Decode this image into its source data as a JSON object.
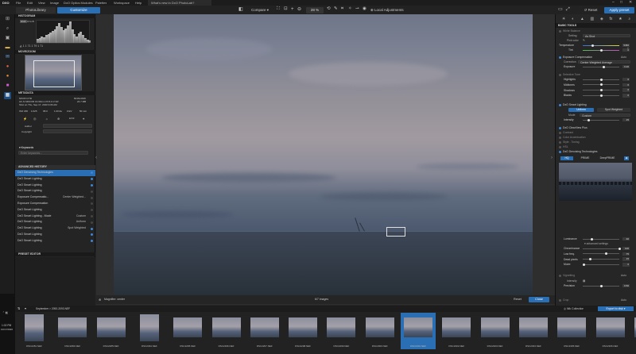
{
  "titlebar": {
    "app_name": "DXO",
    "menu": [
      "File",
      "Edit",
      "View",
      "Image",
      "DxO Optics Modules",
      "Palettes",
      "Workspace",
      "Help"
    ],
    "doc_tab": "What's new in DxO PhotoLab?"
  },
  "toolbar": {
    "tab_library": "PhotoLibrary",
    "tab_customize": "Customize",
    "compare_label": "Compare",
    "zoom_value": "28 %",
    "local_adjustments": "Local Adjustments",
    "reset_label": "Reset",
    "apply_preset": "Apply preset"
  },
  "left_panel": {
    "histogram_title": "HISTOGRAM",
    "histogram_channels": [
      "RGB",
      "R",
      "G",
      "B",
      "L"
    ],
    "histogram_values": [
      "1",
      "1",
      "71",
      "1",
      "79",
      "1",
      "71"
    ],
    "histogram_bars": [
      0.18,
      0.22,
      0.3,
      0.26,
      0.34,
      0.4,
      0.48,
      0.55,
      0.62,
      0.74,
      0.9,
      0.7,
      0.58,
      0.66,
      0.8,
      0.95,
      0.62,
      0.4,
      0.3,
      0.42,
      0.5,
      0.36,
      0.22,
      0.14,
      0.1
    ],
    "move_zoom_title": "MOVE/ZOOM",
    "metadata_title": "METADATA",
    "meta_camera": "NIKON Z 50",
    "meta_res": "6016x4016",
    "meta_lens": "AF-S NIKKOR 16-50mm f/3.5-6.3 VR",
    "meta_size": "24.7 MB",
    "meta_date": "Shot on Thu, Sep 17, 2020 9:06 AM",
    "exif": [
      "ISO 180",
      "1/125",
      "f/8.0",
      "1.00 Ev",
      "0 EV",
      "50 mm"
    ],
    "meta_icons_label": "EXIF",
    "author_label": "Author",
    "copyright_label": "Copyright",
    "keywords_label": "Keywords",
    "keywords_placeholder": "Enter keywords...",
    "adv_history_title": "ADVANCED HISTORY",
    "history_items": [
      {
        "label": "DxO Denoising Technologies",
        "value": "",
        "selected": true
      },
      {
        "label": "DxO Smart Lighting",
        "value": "",
        "selected": false
      },
      {
        "label": "DxO Smart Lighting",
        "value": "",
        "selected": false
      },
      {
        "label": "DxO Smart Lighting",
        "value": "",
        "selected": false
      },
      {
        "label": "Exposure Compensatio...",
        "value": "Center Weighted...",
        "selected": false
      },
      {
        "label": "Exposure Compensation",
        "value": "",
        "selected": false
      },
      {
        "label": "DxO Smart Lighting",
        "value": "",
        "selected": false
      },
      {
        "label": "DxO Smart Lighting - Mode",
        "value": "Custom",
        "selected": false
      },
      {
        "label": "DxO Smart Lighting",
        "value": "Uniform",
        "selected": false
      },
      {
        "label": "DxO Smart Lighting",
        "value": "Spot Weighted",
        "selected": false
      },
      {
        "label": "DxO Smart Lighting",
        "value": "",
        "selected": false
      },
      {
        "label": "DxO Smart Lighting",
        "value": "",
        "selected": false
      }
    ],
    "preset_editor_title": "PRESET EDITOR"
  },
  "viewer": {
    "magnifier_label": "Magnifier: center",
    "count_label": "6/7 images",
    "reset_label": "Reset",
    "close_label": "Close"
  },
  "right_panel": {
    "basic_tools_title": "BASIC TOOLS",
    "white_balance": "White Balance",
    "wb_setting_label": "Setting",
    "wb_setting_value": "As Shot",
    "wb_picker_label": "Pick color",
    "temp_label": "Temperature",
    "temp_value": "5450 K",
    "tint_label": "Tint",
    "tint_value": "0",
    "exposure_title": "Exposure Compensation",
    "exposure_auto": "Auto",
    "correction_label": "Correction",
    "correction_value": "Center Weighted Average",
    "exposure_label": "Exposure",
    "exposure_value": "0.20",
    "selective_tone": "Selective Tone",
    "tones": [
      {
        "label": "Highlights",
        "value": "0"
      },
      {
        "label": "Midtones",
        "value": "0"
      },
      {
        "label": "Shadows",
        "value": "0"
      },
      {
        "label": "Blacks",
        "value": "0"
      }
    ],
    "smart_lighting_title": "DxO Smart Lighting",
    "sl_uniform": "Uniform",
    "sl_spot": "Spot Weighted",
    "sl_mode_label": "Mode",
    "sl_mode_value": "Custom",
    "sl_intensity_label": "Intensity",
    "sl_intensity_value": "15",
    "clearview_title": "DxO ClearView Plus",
    "contrast": "Contrast",
    "color_accent": "Color Accentuation",
    "style_toning": "Style - Toning",
    "hsl": "HSL",
    "denoise_title": "DxO Denoising Technologies",
    "denoise_hq": "HQ",
    "denoise_prime": "PRIME",
    "denoise_deepprime": "DeepPRIME",
    "luminance_label": "Luminance",
    "luminance_value": "40",
    "advanced_settings": "advanced settings",
    "denoise_sliders": [
      {
        "label": "Chrominance",
        "value": "100"
      },
      {
        "label": "Low freq.",
        "value": "75"
      },
      {
        "label": "Dead pixels",
        "value": "15"
      },
      {
        "label": "Moire",
        "value": "0"
      }
    ],
    "vignetting_title": "Vignetting",
    "vignetting_auto": "Auto",
    "vig_intensity_label": "Intensity",
    "precision_label": "Precision",
    "precision_value": "0.50",
    "crop_title": "Crop",
    "crop_auto": "Auto"
  },
  "filmstrip": {
    "bar_text": "September > 2092-2093.NEF",
    "nik_label": "Nik Collection",
    "export_label": "Export to disk",
    "clock_time": "1:02 PM",
    "clock_date": "10/17/2020",
    "thumbs": [
      "DSC2281.NEF",
      "DSC2284.NEF",
      "DSC2285.NEF",
      "DSC2294.NEF",
      "DSC2295.NEF",
      "DSC2296.NEF",
      "DSC2297.NEF",
      "DSC2298.NEF",
      "DSC2299.NEF",
      "DSC2300.NEF",
      "DSC2301.NEF",
      "DSC2302.NEF",
      "DSC2303.NEF",
      "DSC2304.NEF",
      "DSC2305.NEF",
      "DSC2306.NEF",
      "DSC2307.NEF"
    ],
    "selected_index": 10
  },
  "colors": {
    "accent": "#2a6fb3",
    "panel_bg": "#242424",
    "header_bg": "#1a1a1a"
  }
}
